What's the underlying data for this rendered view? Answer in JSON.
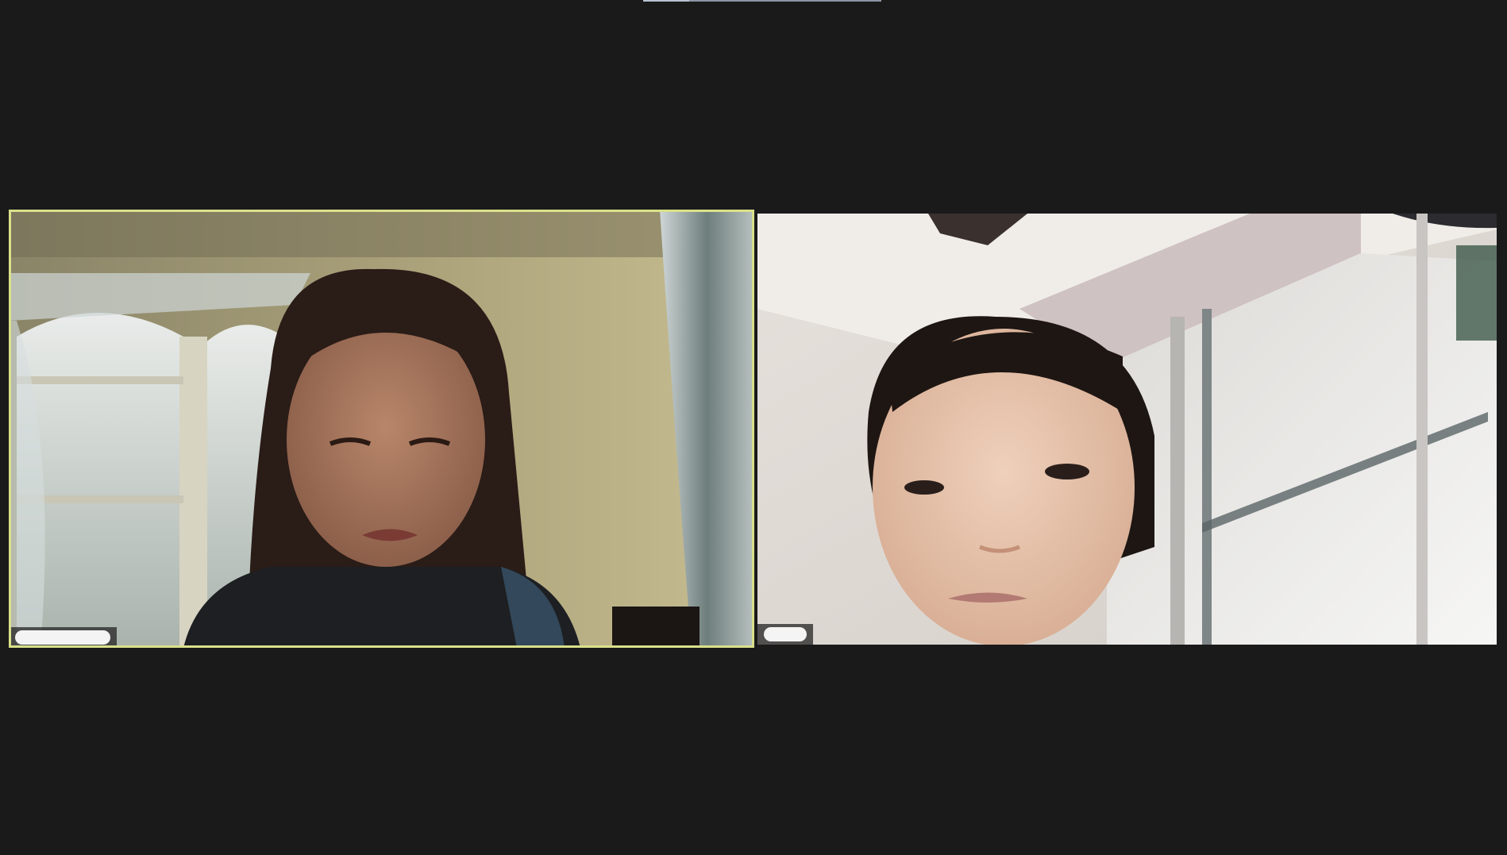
{
  "meeting": {
    "layout": "gallery-view",
    "active_speaker": "participant-1",
    "accent_color": "#d9e08a",
    "background_color": "#1a1a1a"
  },
  "participants": [
    {
      "id": "participant-1",
      "name": "",
      "name_redacted": true,
      "is_active_speaker": true,
      "video_on": true
    },
    {
      "id": "participant-2",
      "name": "",
      "name_redacted": true,
      "is_active_speaker": false,
      "video_on": true
    }
  ]
}
